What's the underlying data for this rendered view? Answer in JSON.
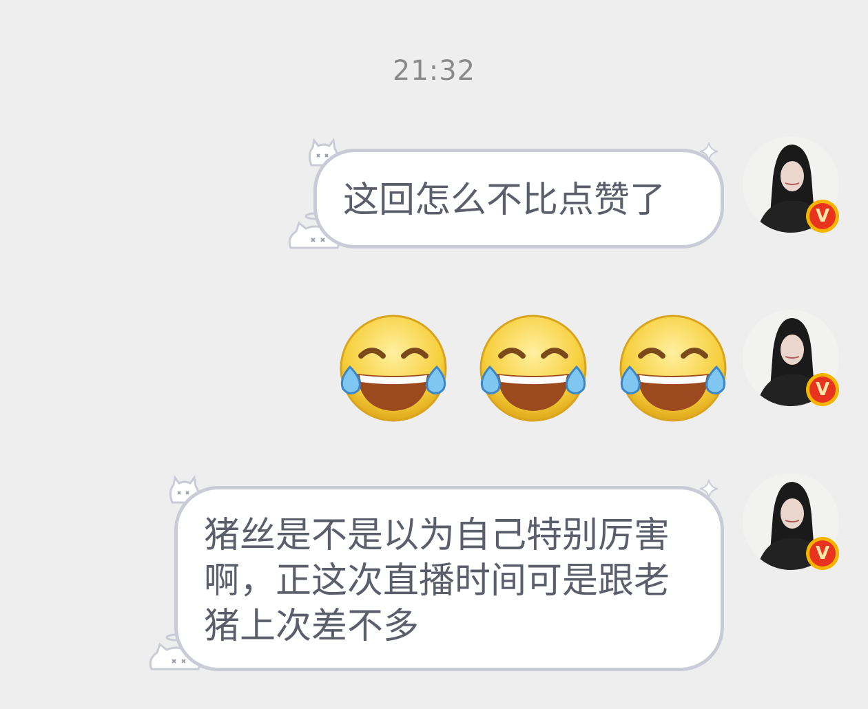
{
  "timestamp": "21:32",
  "messages": [
    {
      "type": "text",
      "text": "这回怎么不比点赞了"
    },
    {
      "type": "emoji",
      "emoji": "laughing-crying-face",
      "count": 3
    },
    {
      "type": "text",
      "text": "猪丝是不是以为自己特别厉害啊，正这次直播时间可是跟老猪上次差不多"
    }
  ],
  "avatar": {
    "badge_text": "V",
    "badge_colors": {
      "ring": "#f5b400",
      "fill": "#e8341e"
    }
  },
  "colors": {
    "background": "#eeeeee",
    "bubble_fill": "#ffffff",
    "bubble_border": "#c9ccd6",
    "message_text": "#5b5f6b",
    "timestamp_text": "#8a8a8a"
  }
}
